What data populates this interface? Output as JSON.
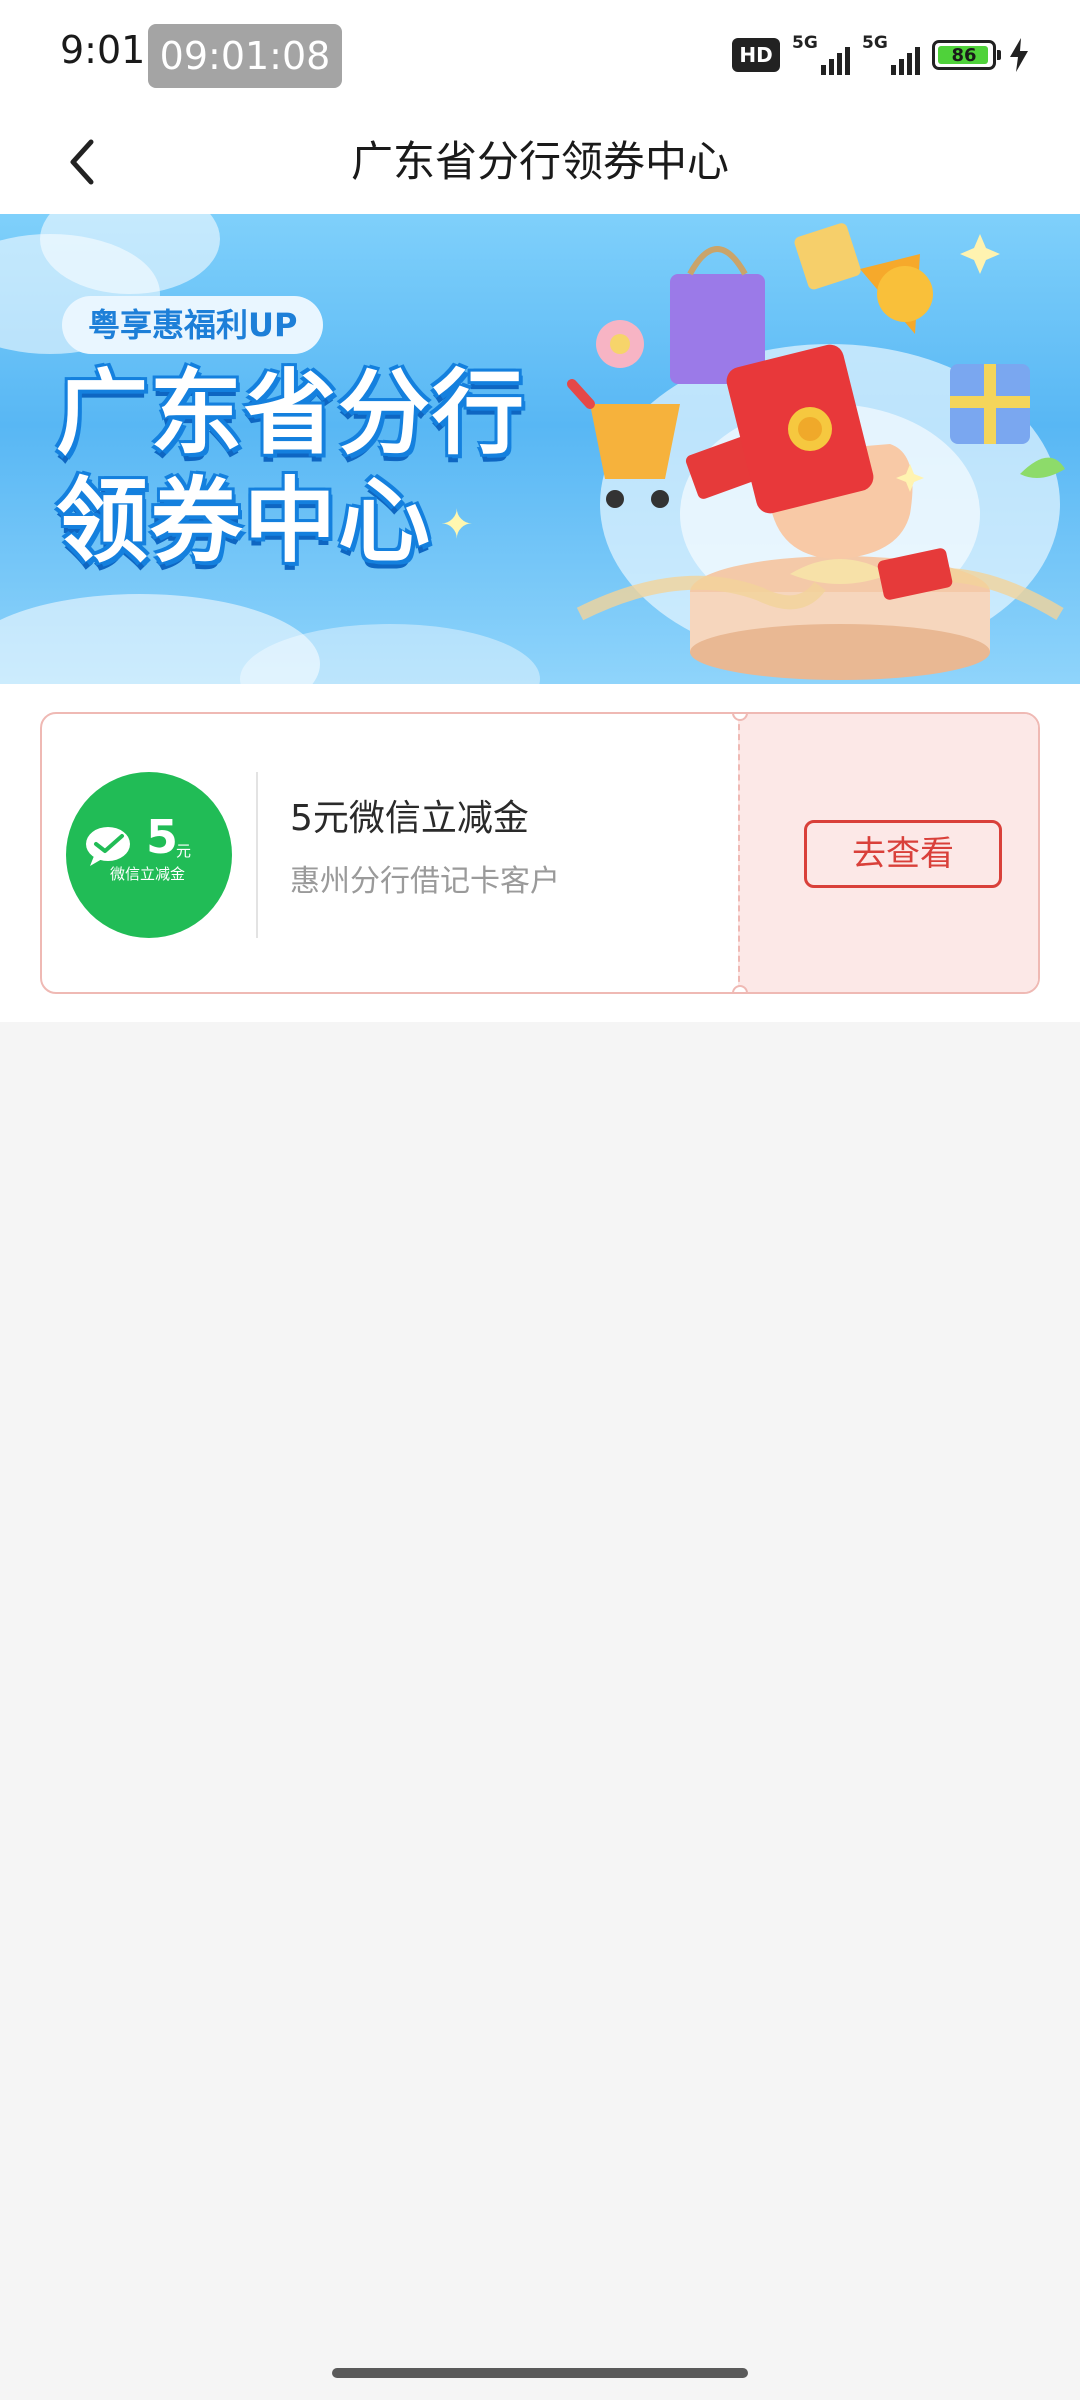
{
  "status_bar": {
    "time": "9:01",
    "clock_chip": "09:01:08",
    "hd_label": "HD",
    "sim1_label": "5G",
    "sim2_label": "5G",
    "battery_level": "86",
    "colors": {
      "battery_fill": "#4fd23a"
    }
  },
  "nav": {
    "title": "广东省分行领券中心",
    "back_icon": "chevron-left-icon"
  },
  "banner": {
    "tag": "粤享惠福利UP",
    "title_line1": "广东省分行",
    "title_line2": "领券中心",
    "colors": {
      "sky": "#58b7f4",
      "title_outline": "#1480de"
    }
  },
  "coupon": {
    "badge_amount": "5",
    "badge_unit": "元",
    "badge_sub": "微信立减金",
    "name": "5元微信立减金",
    "desc": "惠州分行借记卡客户",
    "action_label": "去查看",
    "colors": {
      "badge": "#21bc56",
      "accent": "#d9403a",
      "ticket_bg": "#fce8e7"
    }
  }
}
